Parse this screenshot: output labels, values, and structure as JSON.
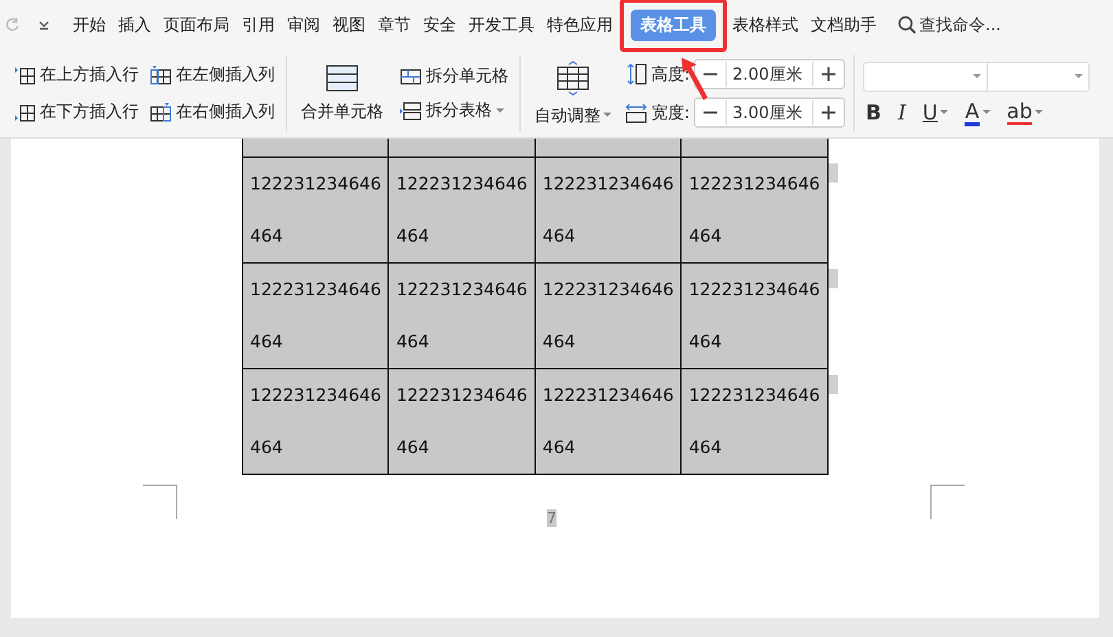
{
  "menu_tabs": [
    {
      "label": "开始",
      "selected": false
    },
    {
      "label": "插入",
      "selected": false
    },
    {
      "label": "页面布局",
      "selected": false
    },
    {
      "label": "引用",
      "selected": false
    },
    {
      "label": "审阅",
      "selected": false
    },
    {
      "label": "视图",
      "selected": false
    },
    {
      "label": "章节",
      "selected": false
    },
    {
      "label": "安全",
      "selected": false
    },
    {
      "label": "开发工具",
      "selected": false
    },
    {
      "label": "特色应用",
      "selected": false
    },
    {
      "label": "表格工具",
      "selected": true
    },
    {
      "label": "表格样式",
      "selected": false
    },
    {
      "label": "文档助手",
      "selected": false
    }
  ],
  "search": {
    "placeholder": "查找命令..."
  },
  "insert_buttons": [
    {
      "label": "在上方插入行",
      "kind": "above"
    },
    {
      "label": "在左侧插入列",
      "kind": "left"
    },
    {
      "label": "在下方插入行",
      "kind": "below"
    },
    {
      "label": "在右侧插入列",
      "kind": "right"
    }
  ],
  "merge_button": {
    "label": "合并单元格"
  },
  "split_buttons": [
    {
      "label": "拆分单元格",
      "dropdown": false
    },
    {
      "label": "拆分表格",
      "dropdown": true
    }
  ],
  "autofit_button": {
    "label": "自动调整"
  },
  "size_fields": [
    {
      "label": "高度:",
      "value": "2.00厘米",
      "kind": "height"
    },
    {
      "label": "宽度:",
      "value": "3.00厘米",
      "kind": "width"
    }
  ],
  "format_buttons": [
    {
      "kind": "bold",
      "label": "B",
      "dropdown": false
    },
    {
      "kind": "italic",
      "label": "I",
      "dropdown": false
    },
    {
      "kind": "underline",
      "label": "U",
      "dropdown": true
    },
    {
      "kind": "color",
      "label": "A",
      "dropdown": true
    },
    {
      "kind": "highlight",
      "label": "ab",
      "dropdown": true
    }
  ],
  "table": {
    "rows": [
      {
        "cells": [
          {},
          {},
          {},
          {}
        ]
      },
      {
        "cells": [
          {
            "lines": [
              "122231234646",
              "464"
            ]
          },
          {
            "lines": [
              "122231234646",
              "464"
            ]
          },
          {
            "lines": [
              "122231234646",
              "464"
            ]
          },
          {
            "lines": [
              "122231234646",
              "464"
            ]
          }
        ]
      },
      {
        "cells": [
          {
            "lines": [
              "122231234646",
              "464"
            ]
          },
          {
            "lines": [
              "122231234646",
              "464"
            ]
          },
          {
            "lines": [
              "122231234646",
              "464"
            ]
          },
          {
            "lines": [
              "122231234646",
              "464"
            ]
          }
        ]
      },
      {
        "cells": [
          {
            "lines": [
              "122231234646",
              "464"
            ]
          },
          {
            "lines": [
              "122231234646",
              "464"
            ]
          },
          {
            "lines": [
              "122231234646",
              "464"
            ]
          },
          {
            "lines": [
              "122231234646",
              "464"
            ]
          }
        ]
      }
    ]
  },
  "page_number": "7"
}
